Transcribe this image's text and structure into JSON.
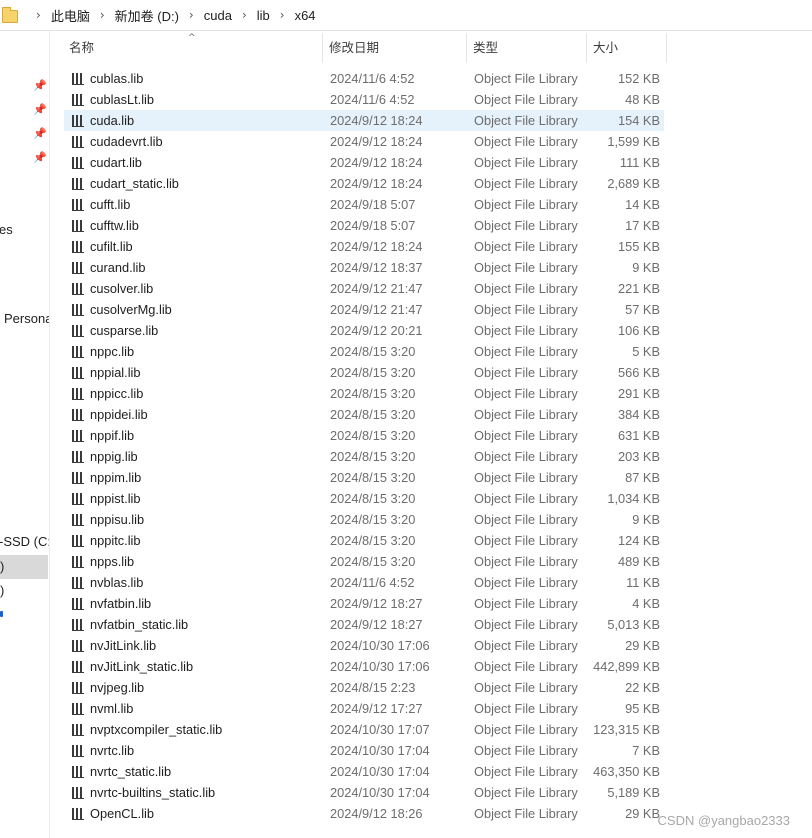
{
  "breadcrumb": [
    "此电脑",
    "新加卷 (D:)",
    "cuda",
    "lib",
    "x64"
  ],
  "columns": {
    "name": "名称",
    "date": "修改日期",
    "type": "类型",
    "size": "大小"
  },
  "nav": {
    "partial_labels": [
      "es",
      "Persona",
      "-SSD (C:)",
      ")",
      ")"
    ]
  },
  "files": [
    {
      "name": "cublas.lib",
      "date": "2024/11/6 4:52",
      "type": "Object File Library",
      "size": "152 KB"
    },
    {
      "name": "cublasLt.lib",
      "date": "2024/11/6 4:52",
      "type": "Object File Library",
      "size": "48 KB"
    },
    {
      "name": "cuda.lib",
      "date": "2024/9/12 18:24",
      "type": "Object File Library",
      "size": "154 KB",
      "selected": true
    },
    {
      "name": "cudadevrt.lib",
      "date": "2024/9/12 18:24",
      "type": "Object File Library",
      "size": "1,599 KB"
    },
    {
      "name": "cudart.lib",
      "date": "2024/9/12 18:24",
      "type": "Object File Library",
      "size": "111 KB"
    },
    {
      "name": "cudart_static.lib",
      "date": "2024/9/12 18:24",
      "type": "Object File Library",
      "size": "2,689 KB"
    },
    {
      "name": "cufft.lib",
      "date": "2024/9/18 5:07",
      "type": "Object File Library",
      "size": "14 KB"
    },
    {
      "name": "cufftw.lib",
      "date": "2024/9/18 5:07",
      "type": "Object File Library",
      "size": "17 KB"
    },
    {
      "name": "cufilt.lib",
      "date": "2024/9/12 18:24",
      "type": "Object File Library",
      "size": "155 KB"
    },
    {
      "name": "curand.lib",
      "date": "2024/9/12 18:37",
      "type": "Object File Library",
      "size": "9 KB"
    },
    {
      "name": "cusolver.lib",
      "date": "2024/9/12 21:47",
      "type": "Object File Library",
      "size": "221 KB"
    },
    {
      "name": "cusolverMg.lib",
      "date": "2024/9/12 21:47",
      "type": "Object File Library",
      "size": "57 KB"
    },
    {
      "name": "cusparse.lib",
      "date": "2024/9/12 20:21",
      "type": "Object File Library",
      "size": "106 KB"
    },
    {
      "name": "nppc.lib",
      "date": "2024/8/15 3:20",
      "type": "Object File Library",
      "size": "5 KB"
    },
    {
      "name": "nppial.lib",
      "date": "2024/8/15 3:20",
      "type": "Object File Library",
      "size": "566 KB"
    },
    {
      "name": "nppicc.lib",
      "date": "2024/8/15 3:20",
      "type": "Object File Library",
      "size": "291 KB"
    },
    {
      "name": "nppidei.lib",
      "date": "2024/8/15 3:20",
      "type": "Object File Library",
      "size": "384 KB"
    },
    {
      "name": "nppif.lib",
      "date": "2024/8/15 3:20",
      "type": "Object File Library",
      "size": "631 KB"
    },
    {
      "name": "nppig.lib",
      "date": "2024/8/15 3:20",
      "type": "Object File Library",
      "size": "203 KB"
    },
    {
      "name": "nppim.lib",
      "date": "2024/8/15 3:20",
      "type": "Object File Library",
      "size": "87 KB"
    },
    {
      "name": "nppist.lib",
      "date": "2024/8/15 3:20",
      "type": "Object File Library",
      "size": "1,034 KB"
    },
    {
      "name": "nppisu.lib",
      "date": "2024/8/15 3:20",
      "type": "Object File Library",
      "size": "9 KB"
    },
    {
      "name": "nppitc.lib",
      "date": "2024/8/15 3:20",
      "type": "Object File Library",
      "size": "124 KB"
    },
    {
      "name": "npps.lib",
      "date": "2024/8/15 3:20",
      "type": "Object File Library",
      "size": "489 KB"
    },
    {
      "name": "nvblas.lib",
      "date": "2024/11/6 4:52",
      "type": "Object File Library",
      "size": "11 KB"
    },
    {
      "name": "nvfatbin.lib",
      "date": "2024/9/12 18:27",
      "type": "Object File Library",
      "size": "4 KB"
    },
    {
      "name": "nvfatbin_static.lib",
      "date": "2024/9/12 18:27",
      "type": "Object File Library",
      "size": "5,013 KB"
    },
    {
      "name": "nvJitLink.lib",
      "date": "2024/10/30 17:06",
      "type": "Object File Library",
      "size": "29 KB"
    },
    {
      "name": "nvJitLink_static.lib",
      "date": "2024/10/30 17:06",
      "type": "Object File Library",
      "size": "442,899 KB"
    },
    {
      "name": "nvjpeg.lib",
      "date": "2024/8/15 2:23",
      "type": "Object File Library",
      "size": "22 KB"
    },
    {
      "name": "nvml.lib",
      "date": "2024/9/12 17:27",
      "type": "Object File Library",
      "size": "95 KB"
    },
    {
      "name": "nvptxcompiler_static.lib",
      "date": "2024/10/30 17:07",
      "type": "Object File Library",
      "size": "123,315 KB"
    },
    {
      "name": "nvrtc.lib",
      "date": "2024/10/30 17:04",
      "type": "Object File Library",
      "size": "7 KB"
    },
    {
      "name": "nvrtc_static.lib",
      "date": "2024/10/30 17:04",
      "type": "Object File Library",
      "size": "463,350 KB"
    },
    {
      "name": "nvrtc-builtins_static.lib",
      "date": "2024/10/30 17:04",
      "type": "Object File Library",
      "size": "5,189 KB"
    },
    {
      "name": "OpenCL.lib",
      "date": "2024/9/12 18:26",
      "type": "Object File Library",
      "size": "29 KB"
    }
  ],
  "icons": {
    "file": "library-file-icon",
    "folder": "folder-icon",
    "pin": "pin-icon"
  },
  "watermark": "CSDN @yangbao2333"
}
